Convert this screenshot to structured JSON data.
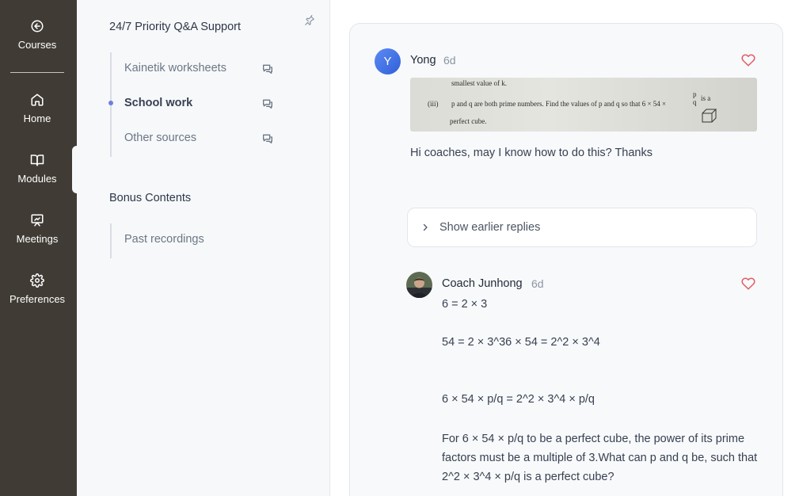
{
  "rail": {
    "items": [
      {
        "label": "Courses",
        "icon": "arrow-left-circle-icon"
      },
      {
        "label": "Home",
        "icon": "home-icon"
      },
      {
        "label": "Modules",
        "icon": "book-open-icon"
      },
      {
        "label": "Meetings",
        "icon": "presentation-icon"
      },
      {
        "label": "Preferences",
        "icon": "gear-icon"
      }
    ],
    "active": "Modules"
  },
  "nav": {
    "section1_title": "24/7 Priority Q&A Support",
    "section1_items": [
      {
        "label": "Kainetik worksheets",
        "active": false
      },
      {
        "label": "School work",
        "active": true
      },
      {
        "label": "Other sources",
        "active": false
      }
    ],
    "section2_title": "Bonus Contents",
    "section2_items": [
      {
        "label": "Past recordings"
      }
    ]
  },
  "post": {
    "avatar_letter": "Y",
    "author": "Yong",
    "time": "6d",
    "image_text": {
      "line1": "smallest value of k.",
      "label": "(iii)",
      "line2": "p and q are both prime numbers. Find the values of p and q so that 6 × 54 ×",
      "frac_num": "p",
      "frac_den": "q",
      "is_a": "is a",
      "line3": "perfect cube."
    },
    "text": "Hi coaches, may I know how to do this? Thanks"
  },
  "earlier_replies_label": "Show earlier replies",
  "reply": {
    "author": "Coach Junhong",
    "time": "6d",
    "lines": [
      "6 = 2 × 3",
      "54 = 2 × 3^36 × 54 = 2^2 × 3^4",
      "6 × 54 × p/q = 2^2 × 3^4 × p/q"
    ],
    "paragraph": "For 6 × 54 × p/q to be a perfect cube, the power of its prime factors must be a multiple of 3.What can p and q be, such that 2^2 × 3^4 × p/q is a perfect cube?"
  },
  "colors": {
    "rail_bg": "#403c35",
    "nav_bg": "#f7f8fa",
    "accent_dot": "#6e7fe0",
    "heart": "#e25b62"
  }
}
